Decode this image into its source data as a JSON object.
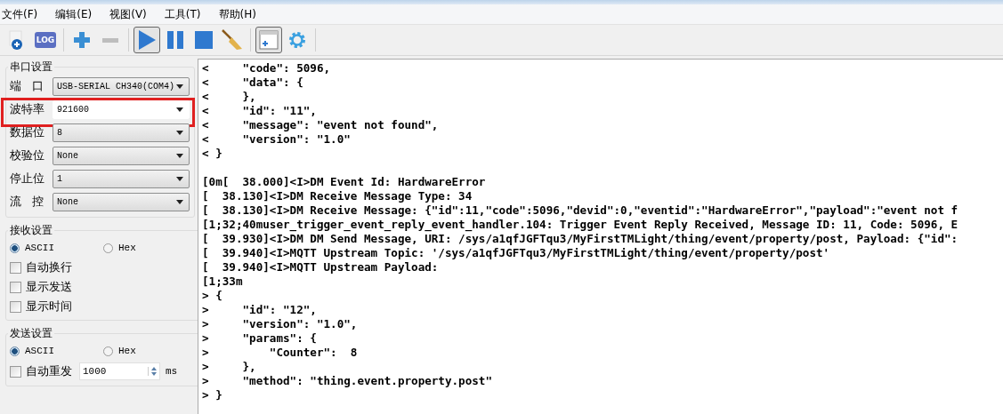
{
  "menu": [
    "文件(F)",
    "编辑(E)",
    "视图(V)",
    "工具(T)",
    "帮助(H)"
  ],
  "toolbar": [
    {
      "kind": "new",
      "pressed": false
    },
    {
      "kind": "log",
      "label": "LOG",
      "pressed": false
    },
    {
      "kind": "sep"
    },
    {
      "kind": "add",
      "pressed": false
    },
    {
      "kind": "remove",
      "pressed": false
    },
    {
      "kind": "sep"
    },
    {
      "kind": "play",
      "pressed": true
    },
    {
      "kind": "pause",
      "pressed": false
    },
    {
      "kind": "stop",
      "pressed": false
    },
    {
      "kind": "clear",
      "pressed": false
    },
    {
      "kind": "sep"
    },
    {
      "kind": "layout",
      "pressed": true
    },
    {
      "kind": "settings",
      "pressed": false
    },
    {
      "kind": "sep"
    }
  ],
  "serial_settings": {
    "title": "串口设置",
    "fields": [
      {
        "label": "端   口",
        "value": "USB-SERIAL CH340(COM4)",
        "editable": false,
        "highlighted": false
      },
      {
        "label": "波特率",
        "value": "921600",
        "editable": true,
        "highlighted": true
      },
      {
        "label": "数据位",
        "value": "8",
        "editable": false,
        "highlighted": false
      },
      {
        "label": "校验位",
        "value": "None",
        "editable": false,
        "highlighted": false
      },
      {
        "label": "停止位",
        "value": "1",
        "editable": false,
        "highlighted": false
      },
      {
        "label": "流   控",
        "value": "None",
        "editable": false,
        "highlighted": false
      }
    ]
  },
  "receive_settings": {
    "title": "接收设置",
    "modes": [
      {
        "label": "ASCII",
        "selected": true
      },
      {
        "label": "Hex",
        "selected": false
      }
    ],
    "options": [
      {
        "label": "自动换行",
        "checked": false
      },
      {
        "label": "显示发送",
        "checked": false
      },
      {
        "label": "显示时间",
        "checked": false
      }
    ]
  },
  "send_settings": {
    "title": "发送设置",
    "modes": [
      {
        "label": "ASCII",
        "selected": true
      },
      {
        "label": "Hex",
        "selected": false
      }
    ],
    "auto_resend": {
      "label": "自动重发",
      "checked": false,
      "value": "1000",
      "unit": "ms"
    }
  },
  "log": {
    "blocks": [
      [
        "<     \"code\": 5096,",
        "<     \"data\": {",
        "<     },",
        "<     \"id\": \"11\",",
        "<     \"message\": \"event not found\",",
        "<     \"version\": \"1.0\"",
        "< }"
      ],
      [
        "[0m[  38.000]<I>DM Event Id: HardwareError",
        "[  38.130]<I>DM Receive Message Type: 34",
        "[  38.130]<I>DM Receive Message: {\"id\":11,\"code\":5096,\"devid\":0,\"eventid\":\"HardwareError\",\"payload\":\"event not f",
        "[1;32;40muser_trigger_event_reply_event_handler.104: Trigger Event Reply Received, Message ID: 11, Code: 5096, E",
        "[  39.930]<I>DM DM Send Message, URI: /sys/a1qfJGFTqu3/MyFirstTMLight/thing/event/property/post, Payload: {\"id\":",
        "[  39.940]<I>MQTT Upstream Topic: '/sys/a1qfJGFTqu3/MyFirstTMLight/thing/event/property/post'",
        "[  39.940]<I>MQTT Upstream Payload:",
        "[1;33m",
        "> {",
        ">     \"id\": \"12\",",
        ">     \"version\": \"1.0\",",
        ">     \"params\": {",
        ">         \"Counter\":  8",
        ">     },",
        ">     \"method\": \"thing.event.property.post\"",
        "> }"
      ]
    ]
  }
}
